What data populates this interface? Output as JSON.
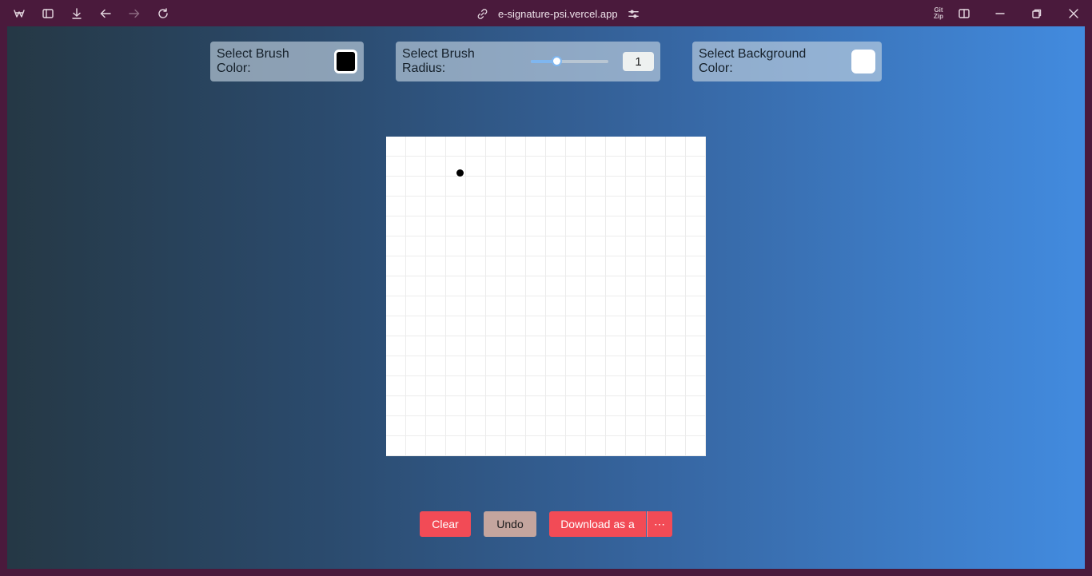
{
  "browser": {
    "url": "e-signature-psi.vercel.app",
    "extension_label": "Git Zip"
  },
  "toolbar": {
    "brush_color_label": "Select Brush Color:",
    "brush_color": "#000000",
    "brush_radius_label": "Select Brush Radius:",
    "brush_radius_value": "1",
    "brush_radius_slider_fraction": 0.33,
    "background_color_label": "Select Background Color:",
    "background_color": "#ffffff"
  },
  "actions": {
    "clear_label": "Clear",
    "undo_label": "Undo",
    "download_label": "Download as a",
    "more_label": "⋯"
  },
  "colors": {
    "accent_red": "#f24b56",
    "undo_tan": "#c4a59e",
    "chrome_bg": "#4a1a3c"
  }
}
